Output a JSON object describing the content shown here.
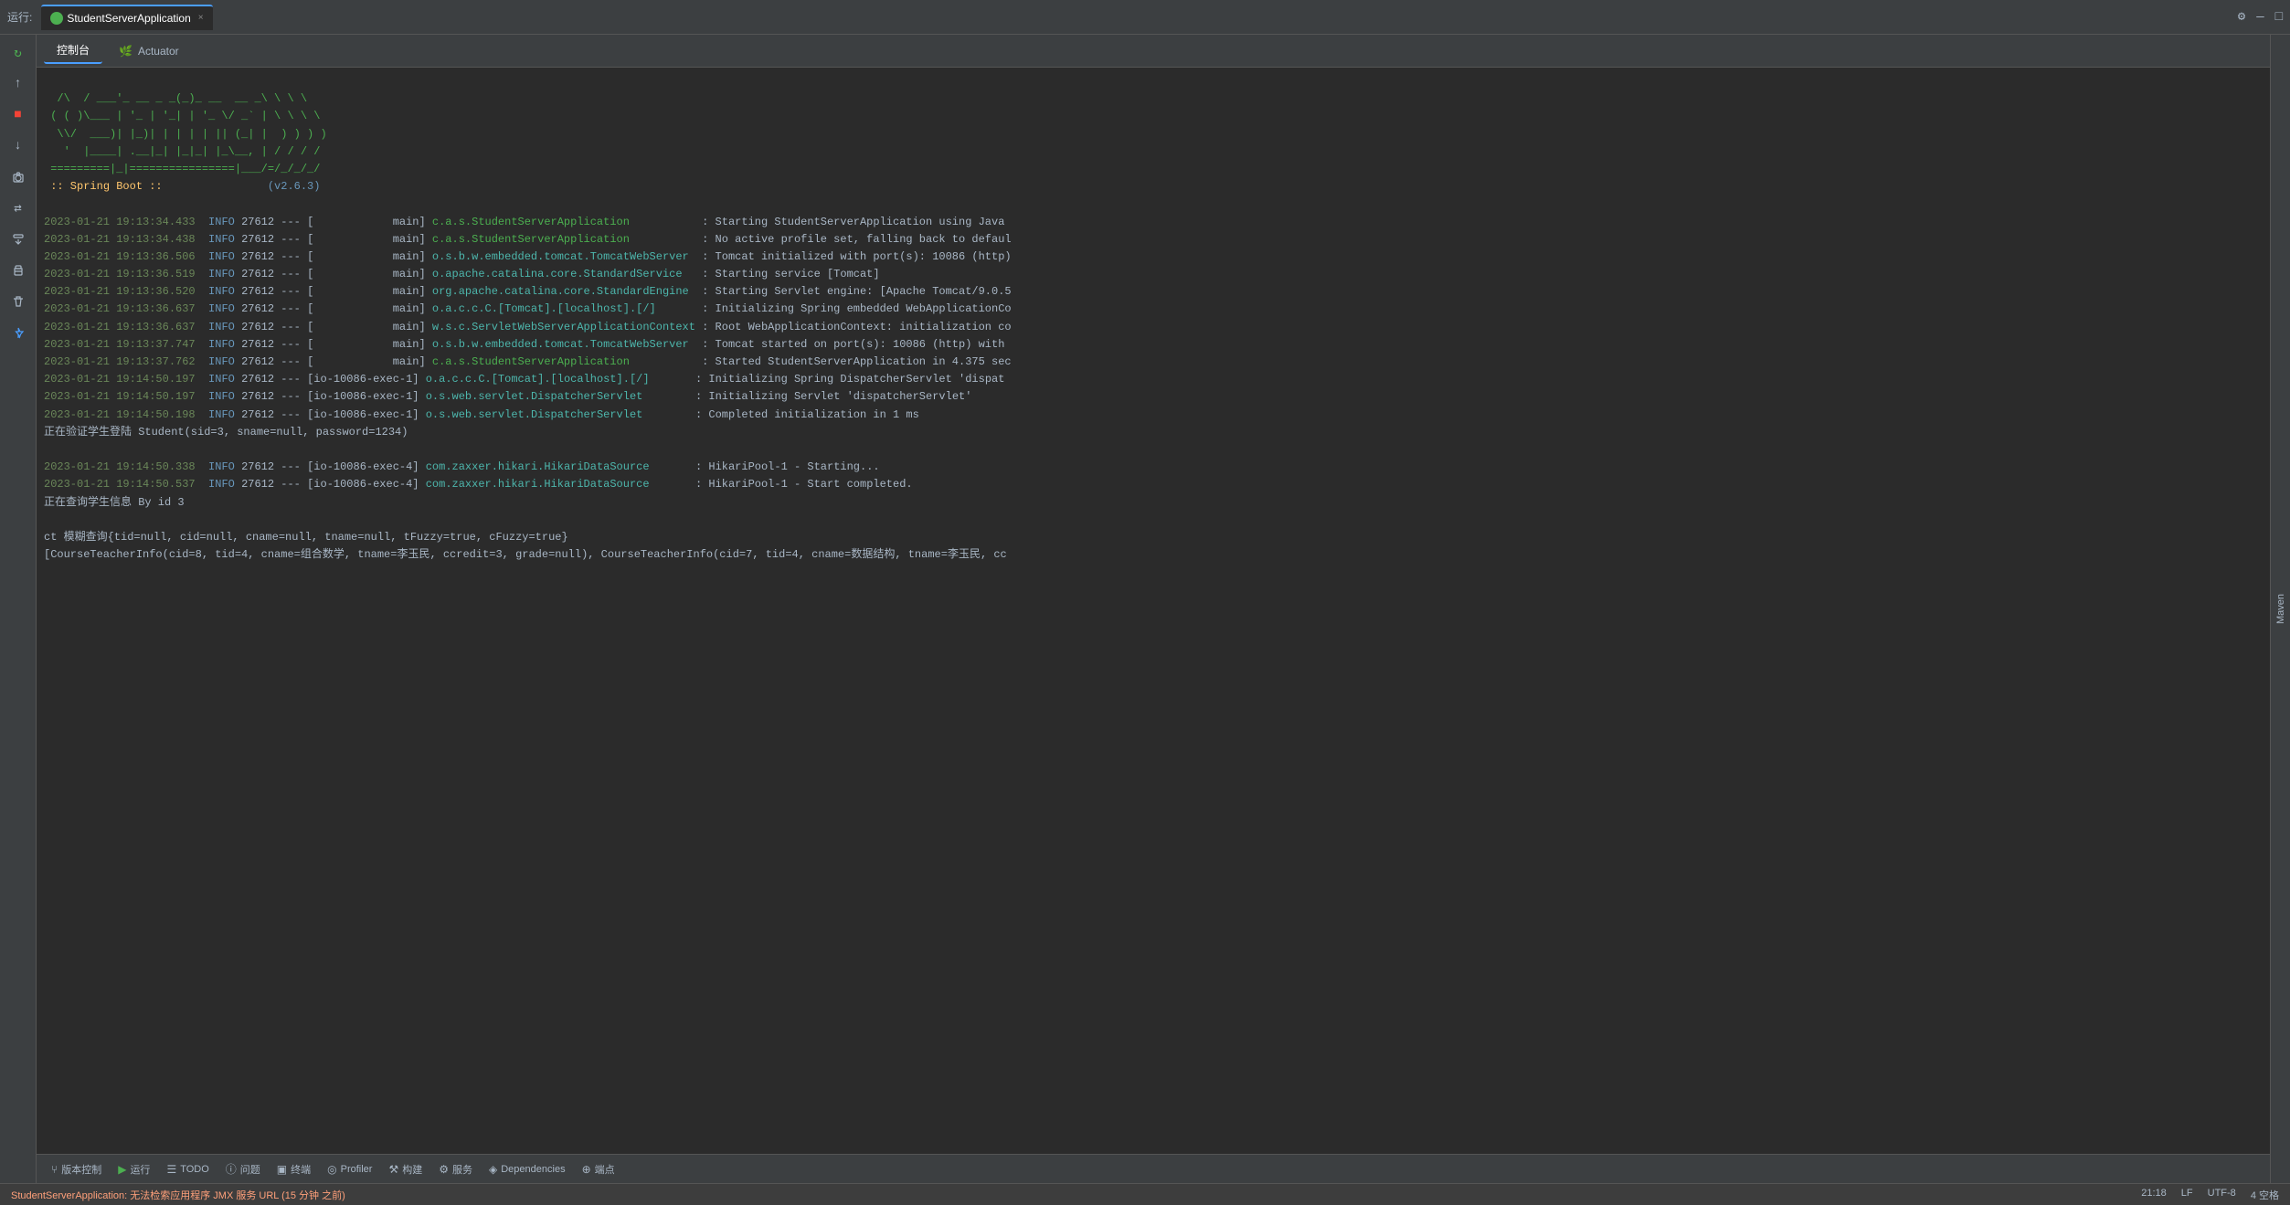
{
  "topbar": {
    "run_label": "运行:",
    "tab_label": "StudentServerApplication",
    "settings_icon": "⚙",
    "minimize_icon": "—",
    "maximize_icon": "□"
  },
  "subtabs": [
    {
      "id": "console",
      "label": "控制台",
      "icon": ""
    },
    {
      "id": "actuator",
      "label": "Actuator",
      "icon": "🌿"
    }
  ],
  "sidebar_buttons": [
    {
      "id": "restart",
      "icon": "↻",
      "active": false
    },
    {
      "id": "up",
      "icon": "↑",
      "active": false
    },
    {
      "id": "stop",
      "icon": "■",
      "active": false,
      "red": true
    },
    {
      "id": "down",
      "icon": "↓",
      "active": false
    },
    {
      "id": "camera",
      "icon": "📷",
      "active": false
    },
    {
      "id": "diff",
      "icon": "⇄",
      "active": false
    },
    {
      "id": "pin",
      "icon": "📌",
      "active": false
    },
    {
      "id": "print",
      "icon": "🖨",
      "active": false
    },
    {
      "id": "trash",
      "icon": "🗑",
      "active": false
    },
    {
      "id": "pinned2",
      "icon": "📍",
      "active": true
    }
  ],
  "console": {
    "banner": [
      "  /\\\\  / ___'_ __ _ _(_)_ __  __ _\\ \\ \\ \\",
      " ( ( )\\___ | '_ | '_| | '_ \\/ _` | \\ \\ \\ \\",
      "  \\\\/  ___)| |_)| | | | | || (_| |  ) ) ) )",
      "   '  |____| .__|_| |_|_| |_\\__, | / / / /",
      " =========|_|================|___/=/_/_/_/"
    ],
    "spring_boot_label": ":: Spring Boot ::",
    "spring_boot_version": "(v2.6.3)",
    "log_lines": [
      {
        "date": "2023-01-21 19:13:34.433",
        "level": "INFO",
        "pid": "27612",
        "sep": "---",
        "thread": "[            main]",
        "class": "c.a.s.StudentServerApplication",
        "class_color": "green",
        "msg": ": Starting StudentServerApplication using Java"
      },
      {
        "date": "2023-01-21 19:13:34.438",
        "level": "INFO",
        "pid": "27612",
        "sep": "---",
        "thread": "[            main]",
        "class": "c.a.s.StudentServerApplication",
        "class_color": "green",
        "msg": ": No active profile set, falling back to defaul"
      },
      {
        "date": "2023-01-21 19:13:36.506",
        "level": "INFO",
        "pid": "27612",
        "sep": "---",
        "thread": "[            main]",
        "class": "o.s.b.w.embedded.tomcat.TomcatWebServer",
        "class_color": "teal",
        "msg": ": Tomcat initialized with port(s): 10086 (http)"
      },
      {
        "date": "2023-01-21 19:13:36.519",
        "level": "INFO",
        "pid": "27612",
        "sep": "---",
        "thread": "[            main]",
        "class": "o.apache.catalina.core.StandardService",
        "class_color": "teal",
        "msg": ": Starting service [Tomcat]"
      },
      {
        "date": "2023-01-21 19:13:36.520",
        "level": "INFO",
        "pid": "27612",
        "sep": "---",
        "thread": "[            main]",
        "class": "org.apache.catalina.core.StandardEngine",
        "class_color": "teal",
        "msg": ": Starting Servlet engine: [Apache Tomcat/9.0.5"
      },
      {
        "date": "2023-01-21 19:13:36.637",
        "level": "INFO",
        "pid": "27612",
        "sep": "---",
        "thread": "[            main]",
        "class": "o.a.c.c.C.[Tomcat].[localhost].[/]",
        "class_color": "teal",
        "msg": ": Initializing Spring embedded WebApplicationCo"
      },
      {
        "date": "2023-01-21 19:13:36.637",
        "level": "INFO",
        "pid": "27612",
        "sep": "---",
        "thread": "[            main]",
        "class": "w.s.c.ServletWebServerApplicationContext",
        "class_color": "teal",
        "msg": ": Root WebApplicationContext: initialization co"
      },
      {
        "date": "2023-01-21 19:13:37.747",
        "level": "INFO",
        "pid": "27612",
        "sep": "---",
        "thread": "[            main]",
        "class": "o.s.b.w.embedded.tomcat.TomcatWebServer",
        "class_color": "teal",
        "msg": ": Tomcat started on port(s): 10086 (http) with"
      },
      {
        "date": "2023-01-21 19:13:37.762",
        "level": "INFO",
        "pid": "27612",
        "sep": "---",
        "thread": "[            main]",
        "class": "c.a.s.StudentServerApplication",
        "class_color": "green",
        "msg": ": Started StudentServerApplication in 4.375 sec"
      },
      {
        "date": "2023-01-21 19:14:50.197",
        "level": "INFO",
        "pid": "27612",
        "sep": "---",
        "thread": "[io-10086-exec-1]",
        "class": "o.a.c.c.C.[Tomcat].[localhost].[/]",
        "class_color": "teal",
        "msg": ": Initializing Spring DispatcherServlet 'dispat"
      },
      {
        "date": "2023-01-21 19:14:50.197",
        "level": "INFO",
        "pid": "27612",
        "sep": "---",
        "thread": "[io-10086-exec-1]",
        "class": "o.s.web.servlet.DispatcherServlet",
        "class_color": "teal",
        "msg": ": Initializing Servlet 'dispatcherServlet'"
      },
      {
        "date": "2023-01-21 19:14:50.198",
        "level": "INFO",
        "pid": "27612",
        "sep": "---",
        "thread": "[io-10086-exec-1]",
        "class": "o.s.web.servlet.DispatcherServlet",
        "class_color": "teal",
        "msg": ": Completed initialization in 1 ms"
      }
    ],
    "plain_lines": [
      "正在验证学生登陆 Student(sid=3, sname=null, password=1234)",
      "",
      "2023-01-21 19:14:50.338  INFO 27612 --- [io-10086-exec-4] com.zaxxer.hikari.HikariDataSource       : HikariPool-1 - Starting...",
      "2023-01-21 19:14:50.537  INFO 27612 --- [io-10086-exec-4] com.zaxxer.hikari.HikariDataSource       : HikariPool-1 - Start completed.",
      "正在查询学生信息 By id 3",
      "",
      "ct 模糊查询{tid=null, cid=null, cname=null, tname=null, tFuzzy=true, cFuzzy=true}",
      "[CourseTeacherInfo(cid=8, tid=4, cname=组合数学, tname=李玉民, ccredit=3, grade=null), CourseTeacherInfo(cid=7, tid=4, cname=数据结构, tname=李玉民, cc"
    ]
  },
  "bottom_toolbar": {
    "buttons": [
      {
        "id": "version-control",
        "icon": "⑂",
        "label": "版本控制"
      },
      {
        "id": "run",
        "icon": "▶",
        "label": "运行",
        "green": true
      },
      {
        "id": "todo",
        "icon": "☰",
        "label": "TODO"
      },
      {
        "id": "problems",
        "icon": "ⓘ",
        "label": "问题"
      },
      {
        "id": "terminal",
        "icon": "▣",
        "label": "终端"
      },
      {
        "id": "profiler",
        "icon": "◎",
        "label": "Profiler"
      },
      {
        "id": "build",
        "icon": "⚒",
        "label": "构建"
      },
      {
        "id": "services",
        "icon": "⚙",
        "label": "服务"
      },
      {
        "id": "dependencies",
        "icon": "◈",
        "label": "Dependencies"
      },
      {
        "id": "endpoints",
        "icon": "⊕",
        "label": "端点"
      }
    ]
  },
  "statusbar": {
    "left_msg": "StudentServerApplication: 无法检索应用程序 JMX 服务 URL (15 分钟 之前)",
    "time": "21:18",
    "encoding": "LF  UTF-8",
    "indent": "4 空格",
    "git": "4 空格"
  },
  "right_sidebar_label": "Maven"
}
